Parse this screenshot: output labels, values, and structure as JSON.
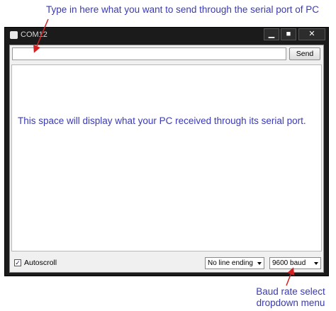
{
  "annotations": {
    "top": "Type in here what you want to send through the serial port of PC",
    "bottom_line1": "Baud rate select",
    "bottom_line2": "dropdown menu"
  },
  "window": {
    "title": "COM12",
    "minimize_glyph": "▁",
    "maximize_glyph": "■",
    "close_glyph": "✕"
  },
  "toolbar": {
    "input_value": "",
    "send_label": "Send"
  },
  "output": {
    "text": "This space will display what your PC received through its serial port."
  },
  "footer": {
    "autoscroll_label": "Autoscroll",
    "autoscroll_checked": true,
    "checkbox_glyph": "✓",
    "line_ending_selected": "No line ending",
    "baud_selected": "9600 baud"
  },
  "colors": {
    "annotation_text": "#3a3ab5",
    "arrow": "#d42020",
    "window_frame": "#1b1b1b"
  }
}
